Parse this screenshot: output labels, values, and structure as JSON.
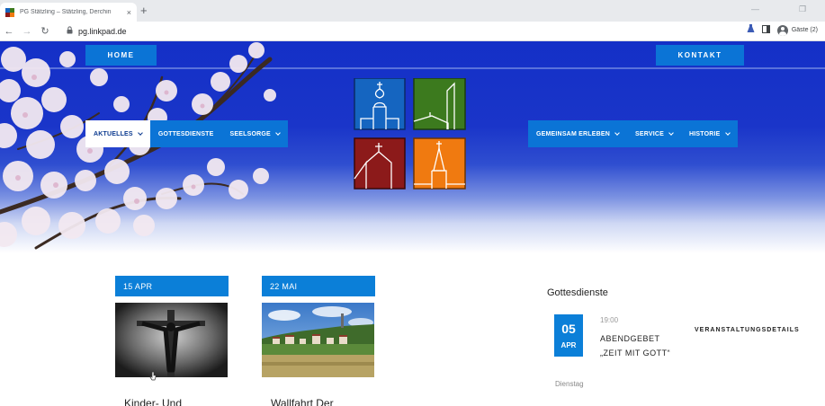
{
  "browser": {
    "tab_title": "PG Stätzling – Stätzling, Derchin",
    "tab_close": "×",
    "new_tab": "+",
    "url": "pg.linkpad.de",
    "profile_label": "Gäste (2)",
    "nav": {
      "back": "←",
      "forward": "→",
      "reload": "↻"
    },
    "icons": {
      "lock": "🔒",
      "extension": "✧",
      "sidebar": "▣"
    }
  },
  "header": {
    "home_label": "HOME",
    "contact_label": "KONTAKT",
    "menu_left": [
      {
        "label": "AKTUELLES",
        "active": true,
        "dropdown": true
      },
      {
        "label": "GOTTESDIENSTE",
        "active": false,
        "dropdown": false
      },
      {
        "label": "SEELSORGE",
        "active": false,
        "dropdown": true
      }
    ],
    "menu_right": [
      {
        "label": "GEMEINSAM ERLEBEN",
        "dropdown": true
      },
      {
        "label": "SERVICE",
        "dropdown": true
      },
      {
        "label": "HISTORIE",
        "dropdown": true
      }
    ],
    "logo_colors": [
      "#1565c0",
      "#3c7a1e",
      "#8c1a1a",
      "#f07a10"
    ]
  },
  "news": [
    {
      "date": "15 APR",
      "title": "Kinder- Und"
    },
    {
      "date": "22 MAI",
      "title": "Wallfahrt Der"
    }
  ],
  "services": {
    "title": "Gottesdienste",
    "event": {
      "day": "05",
      "month": "APR",
      "time": "19:00",
      "name_line1": "ABENDGEBET",
      "name_line2": "„ZEIT MIT GOTT“",
      "details_label": "VERANSTALTUNGSDETAILS",
      "weekday": "Dienstag"
    }
  },
  "colors": {
    "accent": "#0b74d6",
    "hero_blue": "#1430c7"
  }
}
